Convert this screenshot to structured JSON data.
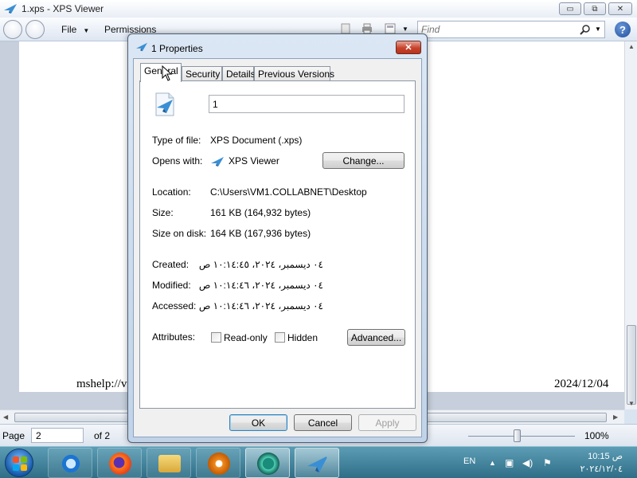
{
  "window": {
    "title": "1.xps - XPS Viewer",
    "menu": {
      "file": "File",
      "permissions": "Permissions"
    },
    "search_placeholder": "Find",
    "help": "?",
    "minimize": "▭",
    "maximize": "⧉",
    "close": "✕"
  },
  "document": {
    "footer_left": "mshelp://v",
    "footer_right": "2024/12/04"
  },
  "statusbar": {
    "page_label": "Page",
    "page_value": "2",
    "of_label": "of 2",
    "zoom": "100%",
    "zoom_level": 0.46
  },
  "dialog": {
    "title": "1 Properties",
    "close_symbol": "✕",
    "tabs": [
      "General",
      "Security",
      "Details",
      "Previous Versions"
    ],
    "selected_tab": "General",
    "file_name": "1",
    "type_label": "Type of file:",
    "type_value": "XPS Document (.xps)",
    "opens_label": "Opens with:",
    "opens_value": "XPS Viewer",
    "change_button": "Change...",
    "location_label": "Location:",
    "location_value": "C:\\Users\\VM1.COLLABNET\\Desktop",
    "size_label": "Size:",
    "size_value": "161 KB (164,932 bytes)",
    "size_disk_label": "Size on disk:",
    "size_disk_value": "164 KB (167,936 bytes)",
    "created_label": "Created:",
    "created_value": "‏٠٤ ديسمبر، ٢٠٢٤، ١٠:١٤:٤٥ ص",
    "modified_label": "Modified:",
    "modified_value": "‏٠٤ ديسمبر، ٢٠٢٤، ١٠:١٤:٤٦ ص",
    "accessed_label": "Accessed:",
    "accessed_value": "‏٠٤ ديسمبر، ٢٠٢٤، ١٠:١٤:٤٦ ص",
    "attributes_label": "Attributes:",
    "readonly_label": "Read-only",
    "hidden_label": "Hidden",
    "advanced_button": "Advanced...",
    "ok_button": "OK",
    "cancel_button": "Cancel",
    "apply_button": "Apply"
  },
  "taskbar": {
    "language": "EN",
    "time": "ص 10:15",
    "date": "٢٠٢٤/١٢/٠٤"
  },
  "colors": {
    "taskbar": "#2f6e86",
    "dialog_frame": "#c1d3e8",
    "close_red": "#c7432c",
    "default_button_border": "#3c7fb1"
  }
}
